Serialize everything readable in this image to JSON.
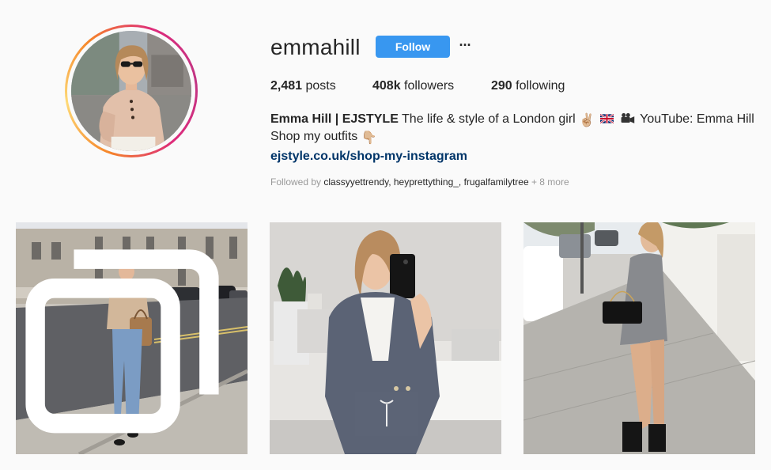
{
  "profile": {
    "username": "emmahill",
    "follow_label": "Follow",
    "more_label": "···",
    "stats": {
      "posts_count": "2,481",
      "posts_label": "posts",
      "followers_count": "408k",
      "followers_label": "followers",
      "following_count": "290",
      "following_label": "following"
    },
    "bio": {
      "name": "Emma Hill | EJSTYLE",
      "line1_text": " The life & style of a London girl ",
      "line1_emojis": [
        "✌🏼",
        "🇬🇧",
        "🎥"
      ],
      "line1_youtube": " YouTube: Emma Hill",
      "line2_text": "Shop my outfits ",
      "line2_emoji": "👇🏼",
      "link": "ejstyle.co.uk/shop-my-instagram"
    },
    "followed_by": {
      "prefix": "Followed by ",
      "users": [
        "classyyettrendy",
        "heyprettything_",
        "frugalfamilytree"
      ],
      "separator": ", ",
      "suffix": " + 8 more"
    }
  },
  "posts": [
    {
      "icon": "multiple-photos-icon"
    },
    {
      "icon": ""
    },
    {
      "icon": ""
    }
  ],
  "colors": {
    "follow_button": "#3897f0",
    "link": "#003569",
    "muted": "#999999",
    "text": "#262626",
    "background": "#fafafa"
  }
}
